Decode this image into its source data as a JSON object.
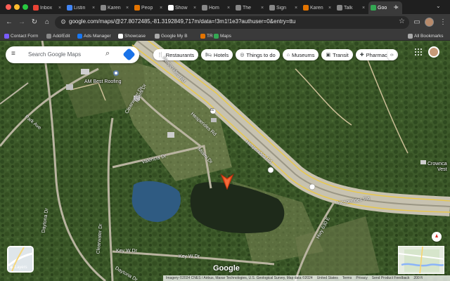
{
  "browser": {
    "tabs": [
      {
        "label": "Inbox",
        "icon": "gmail-icon",
        "color": "#ea4335",
        "active": false
      },
      {
        "label": "Listin",
        "icon": "drive-icon",
        "color": "#4285f4",
        "active": false
      },
      {
        "label": "Karen",
        "icon": "karen-icon",
        "color": "#888888",
        "active": false
      },
      {
        "label": "Peop",
        "icon": "people-icon",
        "color": "#e37400",
        "active": false
      },
      {
        "label": "Show",
        "icon": "showcase-icon",
        "color": "#ffffff",
        "active": false
      },
      {
        "label": "Hom",
        "icon": "home-icon",
        "color": "#888888",
        "active": false
      },
      {
        "label": "The",
        "icon": "the-icon",
        "color": "#888888",
        "active": false
      },
      {
        "label": "Sign",
        "icon": "sign-icon",
        "color": "#888888",
        "active": false
      },
      {
        "label": "Karen",
        "icon": "karen2-icon",
        "color": "#e37400",
        "active": false
      },
      {
        "label": "Talk",
        "icon": "talk-icon",
        "color": "#888888",
        "active": false
      },
      {
        "label": "Goo",
        "icon": "maps-icon",
        "color": "#34a853",
        "active": true
      }
    ],
    "url": "google.com/maps/@27.8072485,-81.3192849,717m/data=!3m1!1e3?authuser=0&entry=ttu",
    "bookmarks": [
      {
        "label": "Contact Form",
        "color": "#7a5cff"
      },
      {
        "label": "Add/Edit",
        "color": "#888888"
      },
      {
        "label": "Ads Manager",
        "color": "#1877f2"
      },
      {
        "label": "Showcase",
        "color": "#ffffff"
      },
      {
        "label": "Google My B",
        "color": "#aaaaaa"
      },
      {
        "label": "TR",
        "color": "#e37400"
      },
      {
        "label": "Maps",
        "color": "#34a853"
      }
    ],
    "all_bookmarks": "All Bookmarks"
  },
  "maps": {
    "search_placeholder": "Search Google Maps",
    "chips": [
      {
        "label": "Restaurants",
        "icon": "fork-knife-icon"
      },
      {
        "label": "Hotels",
        "icon": "bed-icon"
      },
      {
        "label": "Things to do",
        "icon": "camera-icon"
      },
      {
        "label": "Museums",
        "icon": "museum-icon"
      },
      {
        "label": "Transit",
        "icon": "train-icon"
      },
      {
        "label": "Pharmacies",
        "icon": "pill-icon"
      }
    ],
    "place_labels": {
      "am_best": "AM Best Roofing",
      "crowncrest": "Crownca",
      "crowncrest2": "Vest"
    },
    "roads": {
      "hesperides_top": "Hesperides Rd",
      "hesperides_mid": "Hesperides Rd",
      "hesperides_right": "Hesperides Rd",
      "hesperides_right2": "Hesperides Rd",
      "park_ave": "Park Ave",
      "clearwater_top": "Clearwater Dr",
      "clearwater_bottom": "Clearwater Dr",
      "miami_top": "Miami Dr",
      "miami_mid": "Miami Dr",
      "valencia": "Valencia Dr",
      "daytona_left": "Daytona Dr",
      "daytona_bottom": "Daytona Dr",
      "key_w_1": "Key W Dr",
      "key_w_2": "Key W Dr",
      "hwy_630": "Hwy 630 E",
      "route_60": "60"
    },
    "layers_label": "Layers",
    "google_logo": "Google",
    "footer": {
      "attribution": "Imagery ©2024 CNES / Airbus, Maxar Technologies, U.S. Geological Survey, Map data ©2024",
      "country": "United States",
      "terms": "Terms",
      "privacy": "Privacy",
      "feedback": "Send Product Feedback",
      "scale": "200 ft"
    }
  }
}
